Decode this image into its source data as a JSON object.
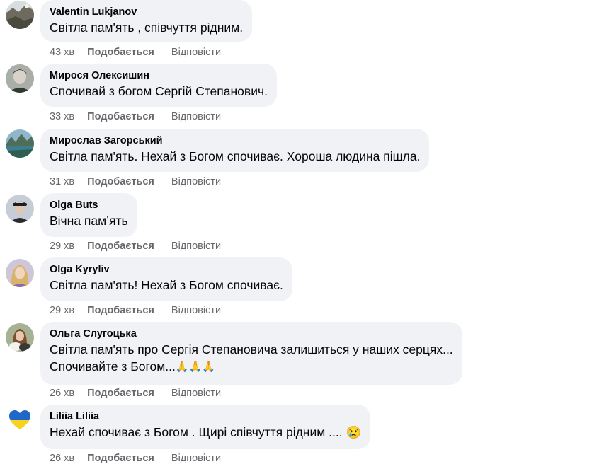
{
  "actions": {
    "like_label": "Подобається",
    "reply_label": "Відповісти"
  },
  "comments": [
    {
      "author": "Valentin Lukjanov",
      "lines": [
        "Світла пам'ять , співчуття рідним."
      ],
      "time": "43 хв",
      "avatar_icon": "landscape-photo-avatar"
    },
    {
      "author": "Мирося Олексишин",
      "lines": [
        "Спочивай з богом Сергій Степанович."
      ],
      "time": "33 хв",
      "avatar_icon": "portrait-photo-avatar"
    },
    {
      "author": "Мирослав Загорський",
      "lines": [
        "Світла пам'ять. Нехай з Богом спочиває. Хороша людина пішла."
      ],
      "time": "31 хв",
      "avatar_icon": "mountain-lake-photo-avatar"
    },
    {
      "author": "Olga Buts",
      "lines": [
        "Вічна пам’ять"
      ],
      "time": "29 хв",
      "avatar_icon": "person-in-cap-photo-avatar"
    },
    {
      "author": "Olga Kyryliv",
      "lines": [
        "Світла пам'ять! Нехай з Богом спочиває."
      ],
      "time": "29 хв",
      "avatar_icon": "blonde-woman-photo-avatar"
    },
    {
      "author": "Ольга Слугоцька",
      "lines": [
        "Світла пам'ять про Сергія Степановича залишиться у наших серцях...",
        "Спочивайте з Богом..."
      ],
      "emoji": "🙏🙏🙏",
      "time": "26 хв",
      "avatar_icon": "woman-with-dog-photo-avatar"
    },
    {
      "author": "Liliia Liliia",
      "lines": [
        "Нехай спочиває з Богом . Щирі співчуття рідним ...."
      ],
      "emoji": "😢",
      "time": "26 хв",
      "avatar_icon": "ukraine-heart-avatar"
    }
  ],
  "colors": {
    "bubble_bg": "#f0f2f5",
    "meta_text": "#65676b",
    "name_text": "#050505"
  }
}
